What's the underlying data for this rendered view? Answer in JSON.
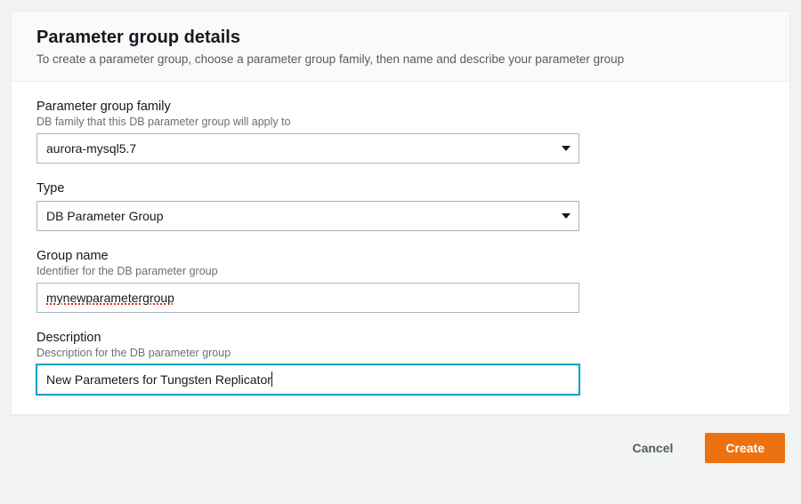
{
  "panel": {
    "title": "Parameter group details",
    "subtitle": "To create a parameter group, choose a parameter group family, then name and describe your parameter group"
  },
  "fields": {
    "family": {
      "label": "Parameter group family",
      "hint": "DB family that this DB parameter group will apply to",
      "value": "aurora-mysql5.7"
    },
    "type": {
      "label": "Type",
      "value": "DB Parameter Group"
    },
    "groupName": {
      "label": "Group name",
      "hint": "Identifier for the DB parameter group",
      "value": "mynewparametergroup"
    },
    "description": {
      "label": "Description",
      "hint": "Description for the DB parameter group",
      "value": "New Parameters for Tungsten Replicator"
    }
  },
  "buttons": {
    "cancel": "Cancel",
    "create": "Create"
  },
  "colors": {
    "primary": "#ec7211",
    "focus": "#00a1c9"
  }
}
